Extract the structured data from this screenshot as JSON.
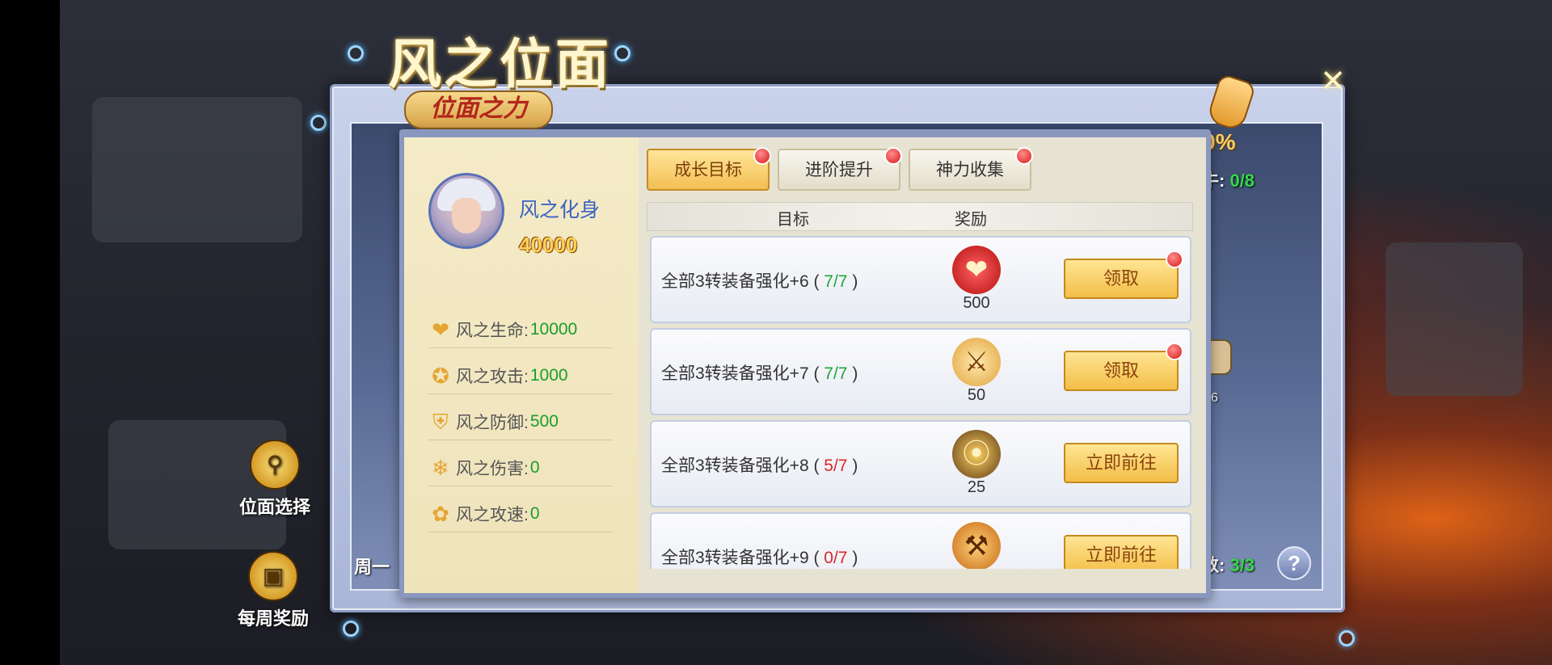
{
  "window": {
    "title": "风之位面",
    "banner": "位面之力",
    "close_icon": "✕"
  },
  "left_menu": [
    {
      "label": "位面选择",
      "icon": "magnifier-icon"
    },
    {
      "label": "每周奖励",
      "icon": "treasure-chest-icon"
    }
  ],
  "background_info": {
    "percent_partial": "0%",
    "condition_label": "牛:",
    "condition_value": "0/8",
    "weekday_partial": "周一",
    "count_label": "数:",
    "count_value": "3/3",
    "node_number": "6",
    "help_symbol": "?"
  },
  "avatar": {
    "name": "风之化身",
    "power": "40000"
  },
  "stats": [
    {
      "icon": "heart-icon",
      "label": "风之生命:",
      "value": "10000"
    },
    {
      "icon": "sword-icon",
      "label": "风之攻击:",
      "value": "1000"
    },
    {
      "icon": "shield-icon",
      "label": "风之防御:",
      "value": "500"
    },
    {
      "icon": "flame-icon",
      "label": "风之伤害:",
      "value": "0"
    },
    {
      "icon": "swirl-icon",
      "label": "风之攻速:",
      "value": "0"
    }
  ],
  "tabs": [
    {
      "label": "成长目标",
      "active": true,
      "has_dot": true
    },
    {
      "label": "进阶提升",
      "active": false,
      "has_dot": true
    },
    {
      "label": "神力收集",
      "active": false,
      "has_dot": true
    }
  ],
  "list_header": {
    "target": "目标",
    "reward": "奖励"
  },
  "tasks": [
    {
      "goal": "全部3转装备强化+6",
      "progress": "7/7",
      "done": true,
      "reward_icon": "heart-gem-icon",
      "reward_count": "500",
      "button": "领取",
      "has_dot": true
    },
    {
      "goal": "全部3转装备强化+7",
      "progress": "7/7",
      "done": true,
      "reward_icon": "sword-scroll-icon",
      "reward_count": "50",
      "button": "领取",
      "has_dot": true
    },
    {
      "goal": "全部3转装备强化+8",
      "progress": "5/7",
      "done": false,
      "reward_icon": "amulet-icon",
      "reward_count": "25",
      "button": "立即前往",
      "has_dot": false
    },
    {
      "goal": "全部3转装备强化+9",
      "progress": "0/7",
      "done": false,
      "reward_icon": "golden-weapon-icon",
      "reward_count": "",
      "button": "立即前往",
      "has_dot": false
    }
  ],
  "colors": {
    "progress_done": "#21a53a",
    "progress_todo": "#d52a2a",
    "stat_value": "#1a9e2a",
    "button_gold": "#f3be47"
  }
}
